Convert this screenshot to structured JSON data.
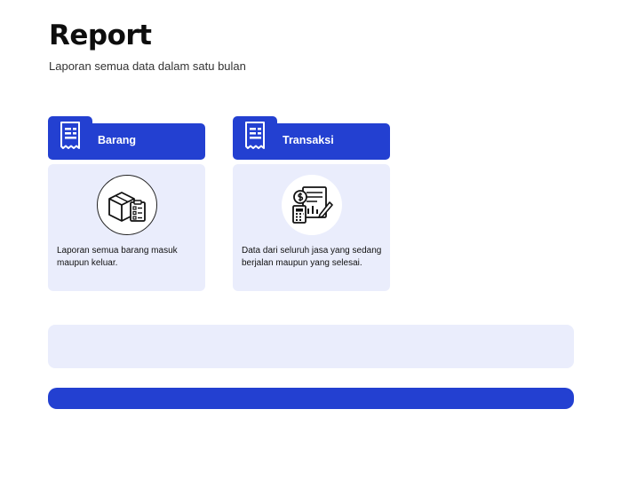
{
  "header": {
    "title": "Report",
    "subtitle": "Laporan semua data dalam satu bulan"
  },
  "cards": [
    {
      "label": "Barang",
      "description": "Laporan semua barang masuk maupun keluar.",
      "header_icon": "receipt-icon",
      "illustration": "box-checklist-icon"
    },
    {
      "label": "Transaksi",
      "description": "Data dari seluruh jasa yang sedang berjalan maupun yang selesai.",
      "header_icon": "receipt-icon",
      "illustration": "payment-invoice-icon"
    }
  ],
  "colors": {
    "primary": "#2340d1",
    "card_background": "#eaedfc",
    "text": "#111111"
  }
}
